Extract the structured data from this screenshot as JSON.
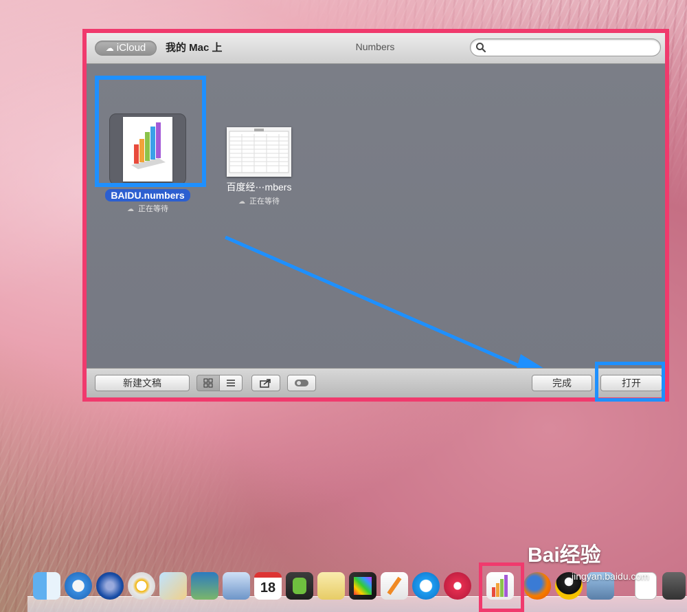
{
  "titlebar": {
    "icloud_label": "iCloud",
    "mac_label": "我的 Mac 上",
    "title": "Numbers",
    "search_placeholder": ""
  },
  "documents": [
    {
      "name": "BAIDU.numbers",
      "status": "正在等待",
      "selected": true,
      "icon": "numbers-chart-icon"
    },
    {
      "name": "百度经⋯mbers",
      "status": "正在等待",
      "selected": false,
      "icon": "spreadsheet-thumb-icon"
    }
  ],
  "bottombar": {
    "new_doc_label": "新建文稿",
    "done_label": "完成",
    "open_label": "打开"
  },
  "dock": {
    "apps": [
      "finder-icon",
      "safari-icon",
      "quicktime-icon",
      "dvd-player-icon",
      "preview-icon",
      "iphoto-icon",
      "mail-icon",
      "calendar-icon",
      "evernote-icon",
      "notes-icon",
      "final-cut-icon",
      "pages-icon",
      "qq-browser-icon",
      "sparrow-icon",
      "numbers-icon",
      "firefox-icon",
      "qq-icon",
      "photo-browser-icon",
      "document-icon",
      "script-icon"
    ],
    "calendar_day": "18"
  },
  "watermark": {
    "brand": "Bai经验",
    "url": "jingyan.baidu.com"
  },
  "colors": {
    "annotation_pink": "#f03a6d",
    "annotation_blue": "#1e90ff"
  }
}
